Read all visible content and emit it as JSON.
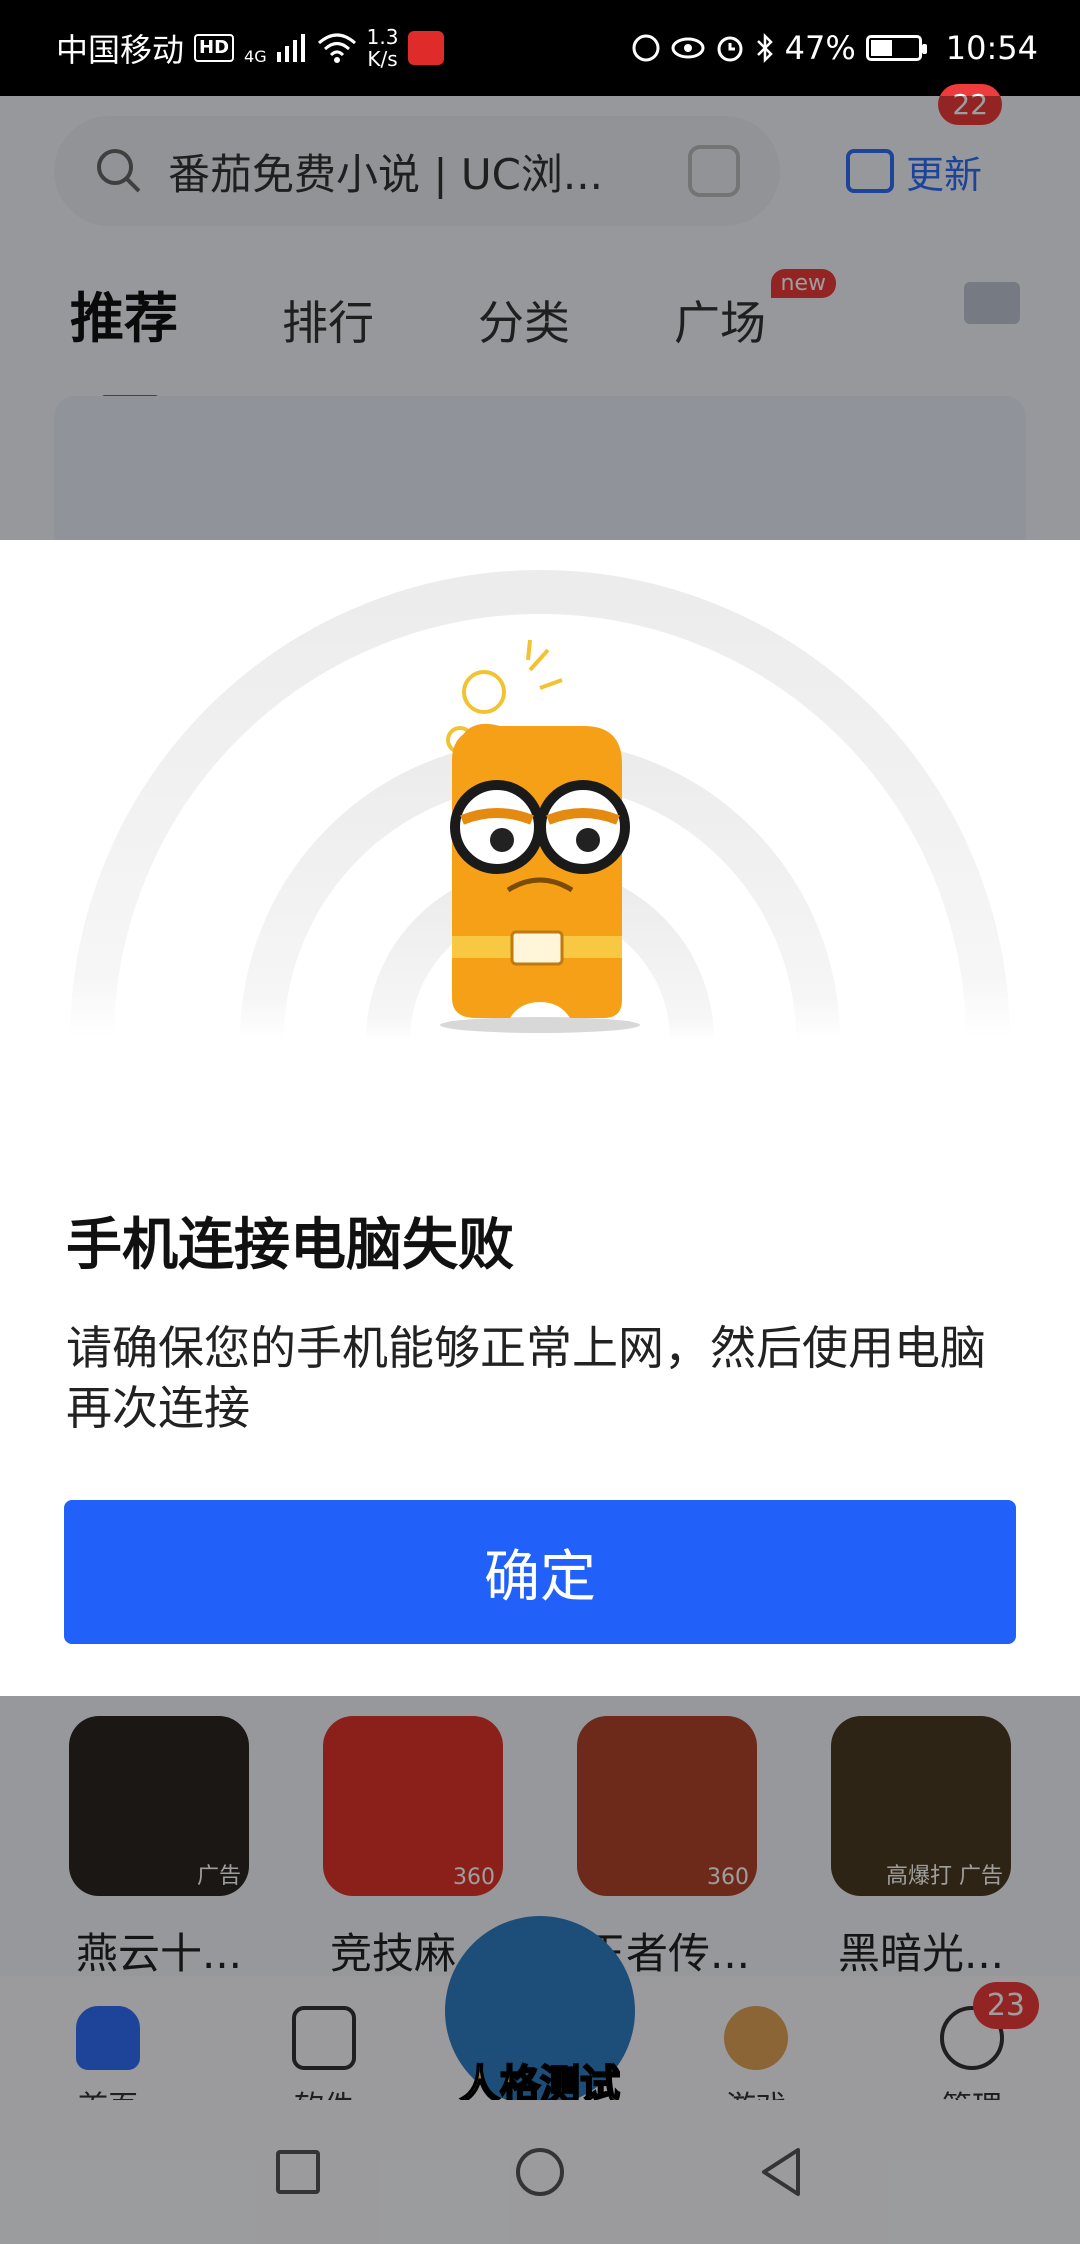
{
  "status_bar": {
    "carrier": "中国移动",
    "hd": "HD",
    "network": "4G",
    "speed_value": "1.3",
    "speed_unit": "K/s",
    "battery": "47%",
    "battery_level": 0.47,
    "time": "10:54"
  },
  "header": {
    "search_text": "番茄免费小说 | UC浏...",
    "update_label": "更新",
    "update_badge": "22"
  },
  "tabs": [
    {
      "label": "推荐",
      "active": true
    },
    {
      "label": "排行"
    },
    {
      "label": "分类"
    },
    {
      "label": "广场",
      "badge": "new"
    }
  ],
  "games": [
    {
      "name": "燕云十...",
      "tag": "广告",
      "color": "#2a2622"
    },
    {
      "name": "竞技麻...",
      "tag": "360",
      "color": "#e0342b"
    },
    {
      "name": "王者传...",
      "tag": "360",
      "color": "#b0452a"
    },
    {
      "name": "黑暗光...",
      "tag": "高爆打 广告",
      "color": "#4a3a22"
    }
  ],
  "bottom_nav": {
    "home": "首页",
    "software": "软件",
    "promo": "人格测试",
    "games": "游戏",
    "manage": "管理",
    "manage_badge": "23"
  },
  "dialog": {
    "title": "手机连接电脑失败",
    "message": "请确保您的手机能够正常上网，然后使用电脑再次连接",
    "confirm_label": "确定",
    "accent_color": "#2160f9"
  }
}
